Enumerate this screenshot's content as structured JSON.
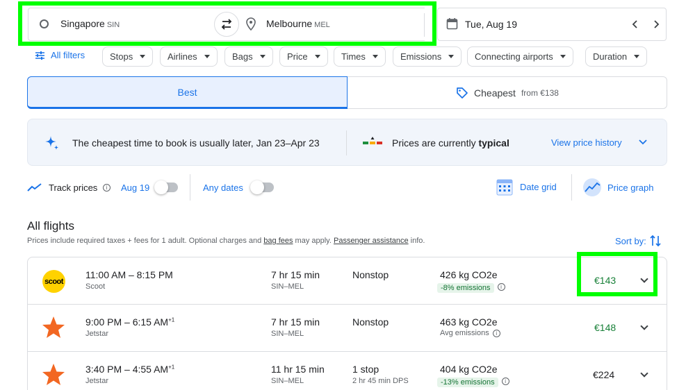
{
  "search": {
    "origin": "Singapore",
    "origin_code": "SIN",
    "destination": "Melbourne",
    "destination_code": "MEL",
    "date": "Tue, Aug 19"
  },
  "filters": {
    "all_filters": "All filters",
    "chips": [
      "Stops",
      "Airlines",
      "Bags",
      "Price",
      "Times",
      "Emissions",
      "Connecting airports",
      "Duration"
    ]
  },
  "tabs": {
    "best": "Best",
    "cheapest": "Cheapest",
    "cheapest_from": "from €138"
  },
  "insight": {
    "text": "The cheapest time to book is usually later, ",
    "range": "Jan 23–Apr 23",
    "prices_text": "Prices are currently ",
    "prices_level": "typical",
    "history_link": "View price history"
  },
  "track": {
    "label": "Track prices",
    "date": "Aug 19",
    "any_dates": "Any dates",
    "date_grid": "Date grid",
    "price_graph": "Price graph"
  },
  "list": {
    "title": "All flights",
    "note_1": "Prices include required taxes + fees for 1 adult. Optional charges and ",
    "bag_fees": "bag fees",
    "note_2": " may apply. ",
    "passenger": "Passenger assistance",
    "note_3": " info.",
    "sort_by": "Sort by:"
  },
  "flights": [
    {
      "times": "11:00 AM – 8:15 PM",
      "plus": "",
      "airline": "Scoot",
      "logo_text": "scoot",
      "duration": "7 hr 15 min",
      "route": "SIN–MEL",
      "stops": "Nonstop",
      "stop_detail": "",
      "emissions": "426 kg CO2e",
      "emissions_note": "-8% emissions",
      "price": "€143",
      "price_color": "#188038"
    },
    {
      "times": "9:00 PM – 6:15 AM",
      "plus": "+1",
      "airline": "Jetstar",
      "logo_text": "",
      "duration": "7 hr 15 min",
      "route": "SIN–MEL",
      "stops": "Nonstop",
      "stop_detail": "",
      "emissions": "463 kg CO2e",
      "emissions_note": "Avg emissions",
      "price": "€148",
      "price_color": "#188038"
    },
    {
      "times": "3:40 PM – 4:55 AM",
      "plus": "+1",
      "airline": "Jetstar",
      "logo_text": "",
      "duration": "11 hr 15 min",
      "route": "SIN–MEL",
      "stops": "1 stop",
      "stop_detail": "2 hr 45 min DPS",
      "emissions": "404 kg CO2e",
      "emissions_note": "-13% emissions",
      "price": "€224",
      "price_color": "#202124"
    }
  ],
  "colors": {
    "accent": "#1a73e8",
    "good_price": "#188038",
    "highlight": "#00ff00"
  }
}
